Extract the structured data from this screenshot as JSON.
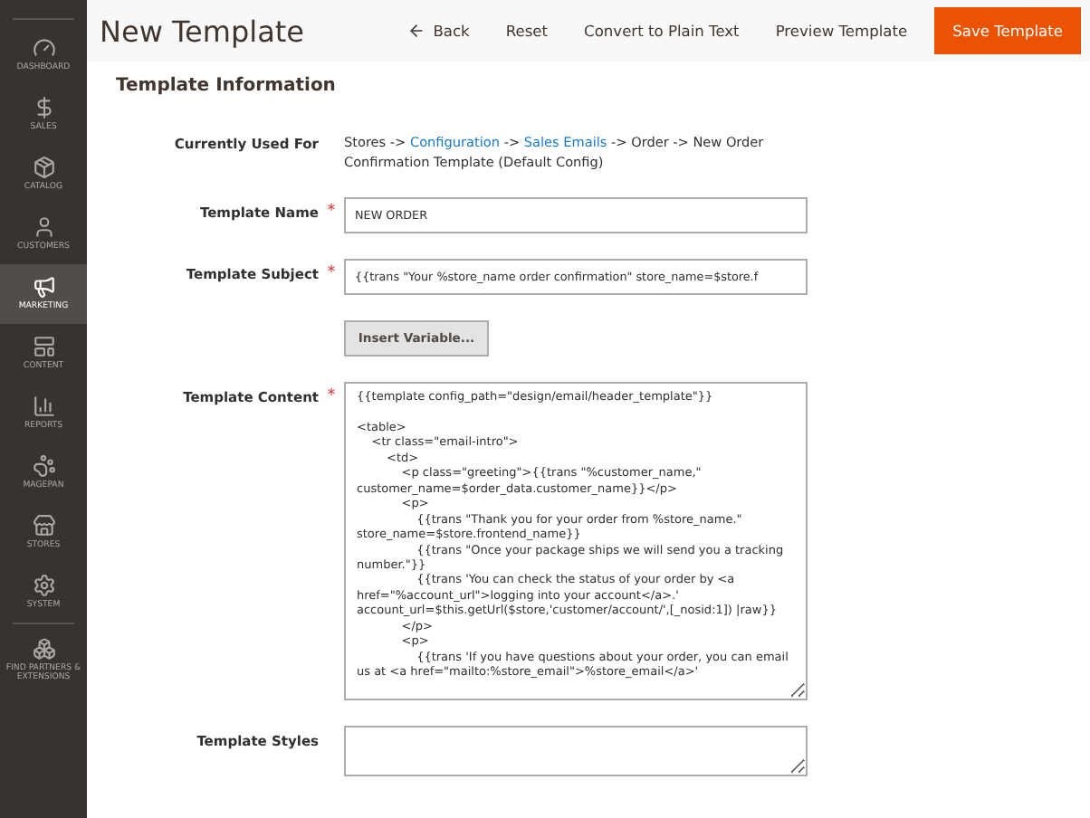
{
  "sidebar": {
    "items": [
      {
        "kind": "dashboard",
        "label": "DASHBOARD",
        "selected": false
      },
      {
        "kind": "sales",
        "label": "SALES",
        "selected": false
      },
      {
        "kind": "catalog",
        "label": "CATALOG",
        "selected": false
      },
      {
        "kind": "customers",
        "label": "CUSTOMERS",
        "selected": false
      },
      {
        "kind": "marketing",
        "label": "MARKETING",
        "selected": true
      },
      {
        "kind": "content",
        "label": "CONTENT",
        "selected": false
      },
      {
        "kind": "reports",
        "label": "REPORTS",
        "selected": false
      },
      {
        "kind": "magepan",
        "label": "MAGEPAN",
        "selected": false
      },
      {
        "kind": "stores",
        "label": "STORES",
        "selected": false
      },
      {
        "kind": "system",
        "label": "SYSTEM",
        "selected": false
      },
      {
        "kind": "partners",
        "label": "FIND PARTNERS & EXTENSIONS",
        "selected": false
      }
    ]
  },
  "header": {
    "title": "New Template",
    "buttons": [
      {
        "kind": "back",
        "label": "Back"
      },
      {
        "kind": "plain",
        "label": "Reset"
      },
      {
        "kind": "plain",
        "label": "Convert to Plain Text"
      },
      {
        "kind": "plain",
        "label": "Preview Template"
      },
      {
        "kind": "primary",
        "label": "Save Template"
      }
    ]
  },
  "section_title": "Template Information",
  "currently_used_for": {
    "label": "Currently Used For",
    "parts": [
      {
        "kind": "text",
        "text": "Stores ->"
      },
      {
        "kind": "link",
        "text": "Configuration"
      },
      {
        "kind": "text",
        "text": "->"
      },
      {
        "kind": "link",
        "text": "Sales Emails"
      },
      {
        "kind": "text",
        "text": "-> Order -> New Order Confirmation Template  (Default Config)"
      }
    ]
  },
  "fields": [
    {
      "kind": "input",
      "label": "Template Name",
      "required": true,
      "value": "NEW ORDER"
    },
    {
      "kind": "input",
      "label": "Template Subject",
      "required": true,
      "value": "{{trans \"Your %store_name order confirmation\" store_name=$store.f"
    },
    {
      "kind": "button",
      "label": "Insert Variable..."
    },
    {
      "kind": "code",
      "label": "Template Content",
      "required": true,
      "value": "{{template config_path=\"design/email/header_template\"}}\n\n<table>\n    <tr class=\"email-intro\">\n        <td>\n            <p class=\"greeting\">{{trans \"%customer_name,\" customer_name=$order_data.customer_name}}</p>\n            <p>\n                {{trans \"Thank you for your order from %store_name.\" store_name=$store.frontend_name}}\n                {{trans \"Once your package ships we will send you a tracking number.\"}}\n                {{trans 'You can check the status of your order by <a href=\"%account_url\">logging into your account</a>.' account_url=$this.getUrl($store,'customer/account/',[_nosid:1]) |raw}}\n            </p>\n            <p>\n                {{trans 'If you have questions about your order, you can email us at <a href=\"mailto:%store_email\">%store_email</a>'"
    },
    {
      "kind": "textarea",
      "label": "Template Styles"
    }
  ],
  "required_symbol": "*"
}
